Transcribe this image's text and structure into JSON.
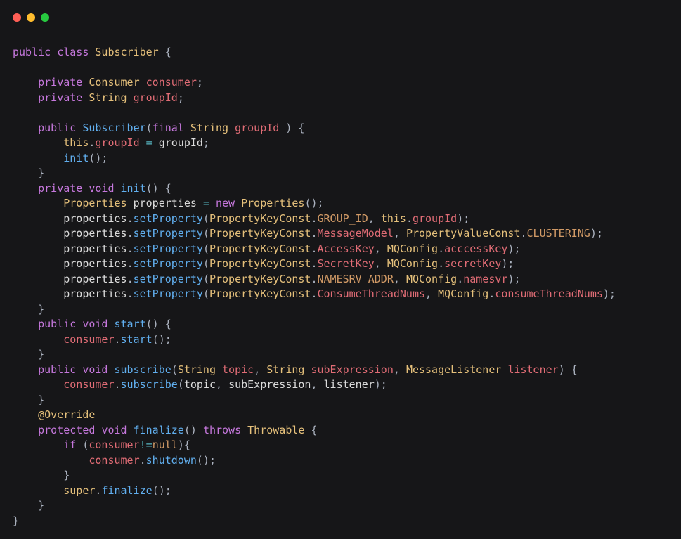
{
  "colors": {
    "bg": "#161618",
    "dot_red": "#ff5f56",
    "dot_yellow": "#ffbd2e",
    "dot_green": "#27c93f"
  },
  "code": {
    "tokens": [
      [
        [
          "kw-mod",
          "public"
        ],
        [
          "plain",
          " "
        ],
        [
          "kw-mod",
          "class"
        ],
        [
          "plain",
          " "
        ],
        [
          "type",
          "Subscriber"
        ],
        [
          "plain",
          " "
        ],
        [
          "punct",
          "{"
        ]
      ],
      [
        [
          "plain",
          ""
        ]
      ],
      [
        [
          "plain",
          "    "
        ],
        [
          "kw-mod",
          "private"
        ],
        [
          "plain",
          " "
        ],
        [
          "type",
          "Consumer"
        ],
        [
          "plain",
          " "
        ],
        [
          "field",
          "consumer"
        ],
        [
          "punct",
          ";"
        ]
      ],
      [
        [
          "plain",
          "    "
        ],
        [
          "kw-mod",
          "private"
        ],
        [
          "plain",
          " "
        ],
        [
          "type",
          "String"
        ],
        [
          "plain",
          " "
        ],
        [
          "field",
          "groupId"
        ],
        [
          "punct",
          ";"
        ]
      ],
      [
        [
          "plain",
          ""
        ]
      ],
      [
        [
          "plain",
          "    "
        ],
        [
          "kw-mod",
          "public"
        ],
        [
          "plain",
          " "
        ],
        [
          "method",
          "Subscriber"
        ],
        [
          "punct",
          "("
        ],
        [
          "kw-mod",
          "final"
        ],
        [
          "plain",
          " "
        ],
        [
          "type",
          "String"
        ],
        [
          "plain",
          " "
        ],
        [
          "param",
          "groupId"
        ],
        [
          "plain",
          " "
        ],
        [
          "punct",
          ")"
        ],
        [
          "plain",
          " "
        ],
        [
          "punct",
          "{"
        ]
      ],
      [
        [
          "plain",
          "        "
        ],
        [
          "kw-this",
          "this"
        ],
        [
          "punct",
          "."
        ],
        [
          "field",
          "groupId"
        ],
        [
          "plain",
          " "
        ],
        [
          "op",
          "="
        ],
        [
          "plain",
          " "
        ],
        [
          "localvar",
          "groupId"
        ],
        [
          "punct",
          ";"
        ]
      ],
      [
        [
          "plain",
          "        "
        ],
        [
          "method",
          "init"
        ],
        [
          "punct",
          "();"
        ]
      ],
      [
        [
          "plain",
          "    "
        ],
        [
          "punct",
          "}"
        ]
      ],
      [
        [
          "plain",
          "    "
        ],
        [
          "kw-mod",
          "private"
        ],
        [
          "plain",
          " "
        ],
        [
          "kw-void",
          "void"
        ],
        [
          "plain",
          " "
        ],
        [
          "method",
          "init"
        ],
        [
          "punct",
          "()"
        ],
        [
          "plain",
          " "
        ],
        [
          "punct",
          "{"
        ]
      ],
      [
        [
          "plain",
          "        "
        ],
        [
          "type",
          "Properties"
        ],
        [
          "plain",
          " "
        ],
        [
          "localvar",
          "properties"
        ],
        [
          "plain",
          " "
        ],
        [
          "op",
          "="
        ],
        [
          "plain",
          " "
        ],
        [
          "kw-ctrl",
          "new"
        ],
        [
          "plain",
          " "
        ],
        [
          "type",
          "Properties"
        ],
        [
          "punct",
          "();"
        ]
      ],
      [
        [
          "plain",
          "        "
        ],
        [
          "localvar",
          "properties"
        ],
        [
          "punct",
          "."
        ],
        [
          "method",
          "setProperty"
        ],
        [
          "punct",
          "("
        ],
        [
          "type",
          "PropertyKeyConst"
        ],
        [
          "punct",
          "."
        ],
        [
          "constfld",
          "GROUP_ID"
        ],
        [
          "punct",
          ", "
        ],
        [
          "kw-this",
          "this"
        ],
        [
          "punct",
          "."
        ],
        [
          "field",
          "groupId"
        ],
        [
          "punct",
          ");"
        ]
      ],
      [
        [
          "plain",
          "        "
        ],
        [
          "localvar",
          "properties"
        ],
        [
          "punct",
          "."
        ],
        [
          "method",
          "setProperty"
        ],
        [
          "punct",
          "("
        ],
        [
          "type",
          "PropertyKeyConst"
        ],
        [
          "punct",
          "."
        ],
        [
          "field",
          "MessageModel"
        ],
        [
          "punct",
          ", "
        ],
        [
          "type",
          "PropertyValueConst"
        ],
        [
          "punct",
          "."
        ],
        [
          "constfld",
          "CLUSTERING"
        ],
        [
          "punct",
          ");"
        ]
      ],
      [
        [
          "plain",
          "        "
        ],
        [
          "localvar",
          "properties"
        ],
        [
          "punct",
          "."
        ],
        [
          "method",
          "setProperty"
        ],
        [
          "punct",
          "("
        ],
        [
          "type",
          "PropertyKeyConst"
        ],
        [
          "punct",
          "."
        ],
        [
          "field",
          "AccessKey"
        ],
        [
          "punct",
          ", "
        ],
        [
          "type",
          "MQConfig"
        ],
        [
          "punct",
          "."
        ],
        [
          "field",
          "acccessKey"
        ],
        [
          "punct",
          ");"
        ]
      ],
      [
        [
          "plain",
          "        "
        ],
        [
          "localvar",
          "properties"
        ],
        [
          "punct",
          "."
        ],
        [
          "method",
          "setProperty"
        ],
        [
          "punct",
          "("
        ],
        [
          "type",
          "PropertyKeyConst"
        ],
        [
          "punct",
          "."
        ],
        [
          "field",
          "SecretKey"
        ],
        [
          "punct",
          ", "
        ],
        [
          "type",
          "MQConfig"
        ],
        [
          "punct",
          "."
        ],
        [
          "field",
          "secretKey"
        ],
        [
          "punct",
          ");"
        ]
      ],
      [
        [
          "plain",
          "        "
        ],
        [
          "localvar",
          "properties"
        ],
        [
          "punct",
          "."
        ],
        [
          "method",
          "setProperty"
        ],
        [
          "punct",
          "("
        ],
        [
          "type",
          "PropertyKeyConst"
        ],
        [
          "punct",
          "."
        ],
        [
          "constfld",
          "NAMESRV_ADDR"
        ],
        [
          "punct",
          ", "
        ],
        [
          "type",
          "MQConfig"
        ],
        [
          "punct",
          "."
        ],
        [
          "field",
          "namesvr"
        ],
        [
          "punct",
          ");"
        ]
      ],
      [
        [
          "plain",
          "        "
        ],
        [
          "localvar",
          "properties"
        ],
        [
          "punct",
          "."
        ],
        [
          "method",
          "setProperty"
        ],
        [
          "punct",
          "("
        ],
        [
          "type",
          "PropertyKeyConst"
        ],
        [
          "punct",
          "."
        ],
        [
          "field",
          "ConsumeThreadNums"
        ],
        [
          "punct",
          ", "
        ],
        [
          "type",
          "MQConfig"
        ],
        [
          "punct",
          "."
        ],
        [
          "field",
          "consumeThreadNums"
        ],
        [
          "punct",
          ");"
        ]
      ],
      [
        [
          "plain",
          "    "
        ],
        [
          "punct",
          "}"
        ]
      ],
      [
        [
          "plain",
          "    "
        ],
        [
          "kw-mod",
          "public"
        ],
        [
          "plain",
          " "
        ],
        [
          "kw-void",
          "void"
        ],
        [
          "plain",
          " "
        ],
        [
          "method",
          "start"
        ],
        [
          "punct",
          "()"
        ],
        [
          "plain",
          " "
        ],
        [
          "punct",
          "{"
        ]
      ],
      [
        [
          "plain",
          "        "
        ],
        [
          "field",
          "consumer"
        ],
        [
          "punct",
          "."
        ],
        [
          "method",
          "start"
        ],
        [
          "punct",
          "();"
        ]
      ],
      [
        [
          "plain",
          "    "
        ],
        [
          "punct",
          "}"
        ]
      ],
      [
        [
          "plain",
          "    "
        ],
        [
          "kw-mod",
          "public"
        ],
        [
          "plain",
          " "
        ],
        [
          "kw-void",
          "void"
        ],
        [
          "plain",
          " "
        ],
        [
          "method",
          "subscribe"
        ],
        [
          "punct",
          "("
        ],
        [
          "type",
          "String"
        ],
        [
          "plain",
          " "
        ],
        [
          "param",
          "topic"
        ],
        [
          "punct",
          ", "
        ],
        [
          "type",
          "String"
        ],
        [
          "plain",
          " "
        ],
        [
          "param",
          "subExpression"
        ],
        [
          "punct",
          ", "
        ],
        [
          "type",
          "MessageListener"
        ],
        [
          "plain",
          " "
        ],
        [
          "param",
          "listener"
        ],
        [
          "punct",
          ")"
        ],
        [
          "plain",
          " "
        ],
        [
          "punct",
          "{"
        ]
      ],
      [
        [
          "plain",
          "        "
        ],
        [
          "field",
          "consumer"
        ],
        [
          "punct",
          "."
        ],
        [
          "method",
          "subscribe"
        ],
        [
          "punct",
          "("
        ],
        [
          "localvar",
          "topic"
        ],
        [
          "punct",
          ", "
        ],
        [
          "localvar",
          "subExpression"
        ],
        [
          "punct",
          ", "
        ],
        [
          "localvar",
          "listener"
        ],
        [
          "punct",
          ");"
        ]
      ],
      [
        [
          "plain",
          "    "
        ],
        [
          "punct",
          "}"
        ]
      ],
      [
        [
          "plain",
          "    "
        ],
        [
          "anno",
          "@Override"
        ]
      ],
      [
        [
          "plain",
          "    "
        ],
        [
          "kw-mod",
          "protected"
        ],
        [
          "plain",
          " "
        ],
        [
          "kw-void",
          "void"
        ],
        [
          "plain",
          " "
        ],
        [
          "method",
          "finalize"
        ],
        [
          "punct",
          "()"
        ],
        [
          "plain",
          " "
        ],
        [
          "kw-throws",
          "throws"
        ],
        [
          "plain",
          " "
        ],
        [
          "type",
          "Throwable"
        ],
        [
          "plain",
          " "
        ],
        [
          "punct",
          "{"
        ]
      ],
      [
        [
          "plain",
          "        "
        ],
        [
          "kw-ctrl",
          "if"
        ],
        [
          "plain",
          " "
        ],
        [
          "punct",
          "("
        ],
        [
          "field",
          "consumer"
        ],
        [
          "op",
          "!="
        ],
        [
          "kw-null",
          "null"
        ],
        [
          "punct",
          "){"
        ]
      ],
      [
        [
          "plain",
          "            "
        ],
        [
          "field",
          "consumer"
        ],
        [
          "punct",
          "."
        ],
        [
          "method",
          "shutdown"
        ],
        [
          "punct",
          "();"
        ]
      ],
      [
        [
          "plain",
          "        "
        ],
        [
          "punct",
          "}"
        ]
      ],
      [
        [
          "plain",
          "        "
        ],
        [
          "kw-super",
          "super"
        ],
        [
          "punct",
          "."
        ],
        [
          "method",
          "finalize"
        ],
        [
          "punct",
          "();"
        ]
      ],
      [
        [
          "plain",
          "    "
        ],
        [
          "punct",
          "}"
        ]
      ],
      [
        [
          "punct",
          "}"
        ]
      ]
    ]
  }
}
